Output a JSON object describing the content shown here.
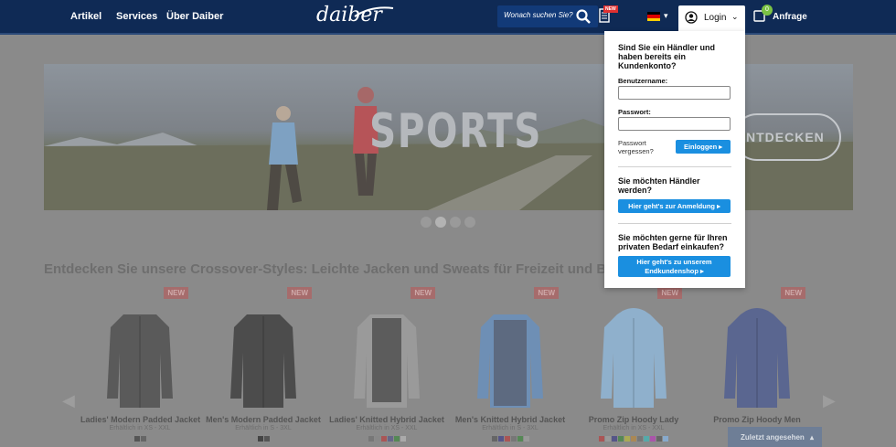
{
  "header": {
    "nav": [
      "Artikel",
      "Services",
      "Über Daiber"
    ],
    "logo": "daiber",
    "search_placeholder": "Wonach suchen Sie?",
    "catalog_badge": "NEW",
    "login_label": "Login",
    "cart_count": "0",
    "cart_label": "Anfrage"
  },
  "hero": {
    "headline": "SPORTS",
    "cta": "NTDECKEN"
  },
  "section_title": "Entdecken Sie unsere Crossover-Styles: Leichte Jacken und Sweats für Freizeit und Beruf",
  "products": [
    {
      "badge": "NEW",
      "name": "Ladies' Modern Padded Jacket",
      "sizes": "Erhältlich in XS - XXL",
      "color": "#5a5a5a"
    },
    {
      "badge": "NEW",
      "name": "Men's Modern Padded Jacket",
      "sizes": "Erhältlich in S - 3XL",
      "color": "#4c4c4c"
    },
    {
      "badge": "NEW",
      "name": "Ladies' Knitted Hybrid Jacket",
      "sizes": "Erhältlich in XS - XXL",
      "color": "#5c5c5c"
    },
    {
      "badge": "NEW",
      "name": "Men's Knitted Hybrid Jacket",
      "sizes": "Erhältlich in S - 3XL",
      "color": "#5d7290"
    },
    {
      "badge": "NEW",
      "name": "Promo Zip Hoody Lady",
      "sizes": "Erhältlich in XS - XXL",
      "color": "#6f8aa0"
    },
    {
      "badge": "NEW",
      "name": "Promo Zip Hoody Men",
      "sizes": "",
      "color": "#4e5a80"
    }
  ],
  "recently_viewed": "Zuletzt angesehen",
  "login_dropdown": {
    "heading": "Sind Sie ein Händler und haben bereits ein Kundenkonto?",
    "username_label": "Benutzername:",
    "password_label": "Passwort:",
    "forgot": "Passwort vergessen?",
    "login_button": "Einloggen",
    "become_dealer": "Sie möchten Händler werden?",
    "register_button": "Hier geht's zur Anmeldung",
    "private_heading": "Sie möchten gerne für Ihren privaten Bedarf einkaufen?",
    "shop_button": "Hier geht's zu unserem Endkundenshop"
  },
  "colors": {
    "header": "#0f2a55",
    "button": "#1a8fe0",
    "cart_badge": "#7bc244",
    "new_badge": "#e03030"
  }
}
